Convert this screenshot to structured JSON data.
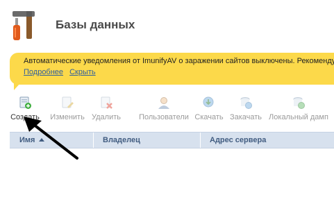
{
  "header": {
    "title": "Базы данных",
    "icon": "tools-icon"
  },
  "notice": {
    "text": "Автоматические уведомления от ImunifyAV о заражении сайтов выключены. Рекомендуем",
    "links": [
      "Подробнее",
      "Скрыть"
    ],
    "color": "#fcd94a"
  },
  "toolbar": {
    "buttons": [
      {
        "label": "Создать",
        "icon": "db-add-icon",
        "enabled": true
      },
      {
        "label": "Изменить",
        "icon": "db-edit-icon",
        "enabled": false
      },
      {
        "label": "Удалить",
        "icon": "db-delete-icon",
        "enabled": false
      },
      {
        "label": "Пользователи",
        "icon": "db-users-icon",
        "enabled": false
      },
      {
        "label": "Скачать",
        "icon": "db-download-icon",
        "enabled": false
      },
      {
        "label": "Закачать",
        "icon": "db-upload-icon",
        "enabled": false
      },
      {
        "label": "Локальный дамп",
        "icon": "db-dump-icon",
        "enabled": false
      }
    ]
  },
  "table": {
    "columns": [
      "Имя",
      "Владелец",
      "Адрес сервера"
    ],
    "sorted_column": "Имя",
    "header_color": "#d7e1ee"
  }
}
